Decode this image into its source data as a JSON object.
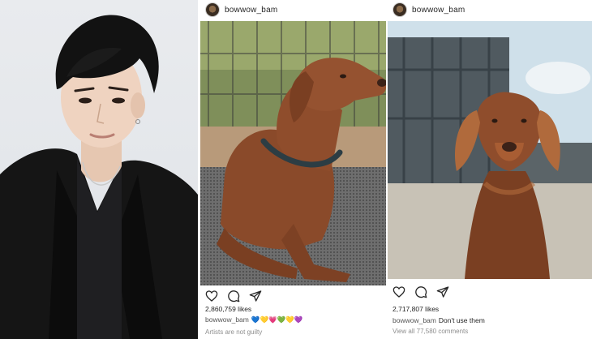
{
  "post1": {
    "username": "bowwow_bam",
    "likes": "2,860,759 likes",
    "caption_user": "bowwow_bam",
    "caption_text": "💙💛💗💚💛💜",
    "subtext": "Artists are not guilty"
  },
  "post2": {
    "username": "bowwow_bam",
    "likes": "2,717,807 likes",
    "caption_user": "bowwow_bam",
    "caption_text": "Don't use them",
    "comments": "View all 77,580 comments"
  },
  "icons": {
    "like": "heart-icon",
    "comment": "comment-icon",
    "share": "paper-plane-icon"
  },
  "colors": {
    "text": "#262626",
    "muted": "#8e8e8e",
    "dog_coat": "#8a4a2a"
  }
}
